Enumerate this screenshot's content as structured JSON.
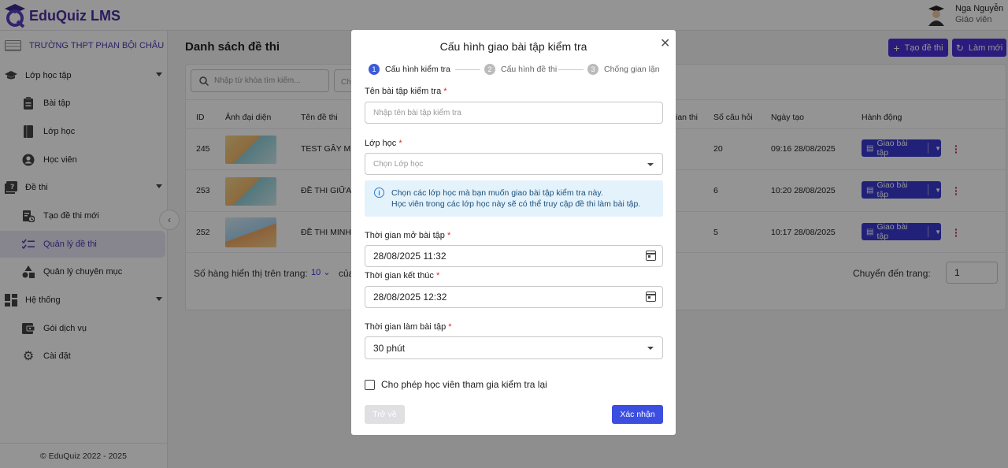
{
  "app": {
    "name": "EduQuiz LMS"
  },
  "user": {
    "name": "Nga Nguyễn",
    "role": "Giáo viên"
  },
  "sidebar": {
    "school": "TRƯỜNG THPT PHAN BỘI CHÂU",
    "items": [
      {
        "label": "Lớp học tập",
        "icon": "graduation-cap-icon"
      },
      {
        "label": "Bài tập",
        "icon": "clipboard-icon"
      },
      {
        "label": "Lớp học",
        "icon": "book-icon"
      },
      {
        "label": "Học viên",
        "icon": "user-circle-icon"
      },
      {
        "label": "Đề thi",
        "icon": "quiz-icon"
      },
      {
        "label": "Tạo đề thi mới",
        "icon": "new-document-icon"
      },
      {
        "label": "Quản lý đề thi",
        "icon": "checklist-icon"
      },
      {
        "label": "Quản lý chuyên mục",
        "icon": "shapes-icon"
      },
      {
        "label": "Hệ thống",
        "icon": "dashboard-icon"
      },
      {
        "label": "Gói dịch vụ",
        "icon": "wallet-icon"
      },
      {
        "label": "Cài đặt",
        "icon": "gear-icon"
      }
    ],
    "copyright": "© EduQuiz 2022 - 2025"
  },
  "main": {
    "title": "Danh sách đề thi",
    "create_label": "Tạo đề thi",
    "refresh_label": "Làm mới",
    "search_placeholder": "Nhập từ khóa tìm kiếm...",
    "filter_placeholder": "Ch",
    "columns": [
      "ID",
      "Ảnh đại diện",
      "Tên đề thi",
      "ian thi",
      "Số câu hỏi",
      "Ngày tạo",
      "Hành động"
    ],
    "rows": [
      {
        "id": "245",
        "name": "TEST GÂY MÊ",
        "questions": "20",
        "created": "09:16 28/08/2025",
        "action": "Giao bài tập"
      },
      {
        "id": "253",
        "name": "ĐỀ THI GIỮA K",
        "questions": "6",
        "created": "10:20 28/08/2025",
        "action": "Giao bài tập"
      },
      {
        "id": "252",
        "name": "ĐỀ THI MINH H",
        "questions": "5",
        "created": "10:17 28/08/2025",
        "action": "Giao bài tập"
      }
    ],
    "pager_label": "Số hàng hiển thị trên trang:",
    "pager_value": "10",
    "pager_of": "của",
    "jump_label": "Chuyển đến trang:",
    "jump_value": "1"
  },
  "modal": {
    "title": "Cấu hình giao bài tập kiểm tra",
    "steps": [
      {
        "num": "1",
        "label": "Cấu hình kiểm tra"
      },
      {
        "num": "2",
        "label": "Cấu hình đề thi"
      },
      {
        "num": "3",
        "label": "Chống gian lận"
      }
    ],
    "name_label": "Tên bài tập kiểm tra",
    "name_placeholder": "Nhập tên bài tập kiểm tra",
    "class_label": "Lớp học",
    "class_placeholder": "Chọn Lớp học",
    "info_line1": "Chọn các lớp học mà bạn muốn giao bài tập kiểm tra này.",
    "info_line2": "Học viên trong các lớp học này sẽ có thể truy cập đề thi làm bài tập.",
    "open_label": "Thời gian mở bài tập",
    "open_value": "28/08/2025 11:32",
    "end_label": "Thời gian kết thúc",
    "end_value": "28/08/2025 12:32",
    "duration_label": "Thời gian làm bài tập",
    "duration_value": "30 phút",
    "retake_label": "Cho phép học viên tham gia kiểm tra lại",
    "back_label": "Trở về",
    "confirm_label": "Xác nhận",
    "required_mark": "*"
  },
  "colors": {
    "brand": "#4a2fa0",
    "primary": "#4a2fd8",
    "accent": "#3b4ee0",
    "danger": "#c0205a"
  }
}
